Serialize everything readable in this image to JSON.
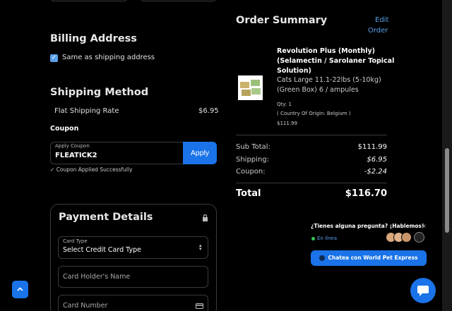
{
  "billing": {
    "title": "Billing Address",
    "same_as_shipping": "Same as shipping address"
  },
  "shipping": {
    "title": "Shipping Method",
    "method": "Flat Shipping Rate",
    "price": "$6.95"
  },
  "coupon": {
    "title": "Coupon",
    "label": "Apply Coupon",
    "value": "FLEATICK2",
    "apply": "Apply",
    "success": "Coupon Applied Successfully"
  },
  "payment": {
    "title": "Payment Details",
    "card_type_label": "Card Type",
    "card_type_value": "Select Credit Card Type",
    "holder_placeholder": "Card Holder's Name",
    "number_placeholder": "Card Number"
  },
  "summary": {
    "title": "Order Summary",
    "edit_line1": "Edit",
    "edit_line2": "Order",
    "product": {
      "name_line1": "Revolution Plus (Monthly)",
      "name_line2": "(Selamectin / Sarolaner Topical",
      "name_line3": "Solution)",
      "variant_line1": "Cats Large 11.1-22lbs (5-10kg)",
      "variant_line2": "(Green Box) 6 / ampules",
      "qty": "Qty: 1",
      "origin": "( Country Of Origin: Belgium )",
      "price": "$111.99"
    },
    "subtotal_label": "Sub Total:",
    "subtotal": "$111.99",
    "shipping_label": "Shipping:",
    "shipping": "$6.95",
    "coupon_label": "Coupon:",
    "coupon": "-$2.24",
    "total_label": "Total",
    "total": "$116.70"
  },
  "chat": {
    "question": "¿Tienes alguna pregunta? ¡Hablemos!",
    "status": "En línea",
    "button": "Chatea con World Pet Express"
  },
  "colors": {
    "accent": "#1a73e8",
    "background": "#000000"
  }
}
